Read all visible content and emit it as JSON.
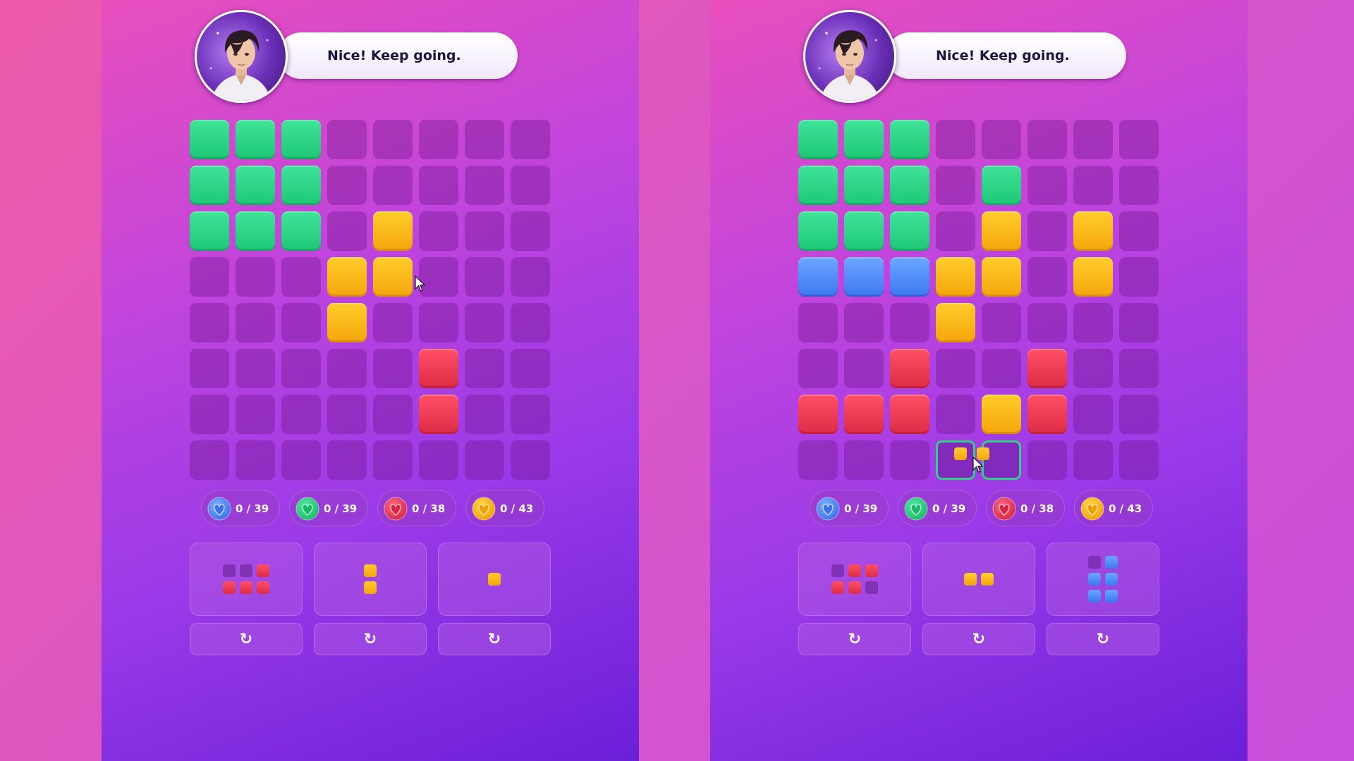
{
  "colors": {
    "green": "#22cc7a",
    "yellow": "#f7b315",
    "red": "#e8364f",
    "blue": "#4a86f5",
    "empty": "#8a2bb0",
    "highlight": "#2fd182"
  },
  "panels": [
    {
      "id": "left",
      "speech": "Nice! Keep going.",
      "grid": [
        [
          "G",
          "G",
          "G",
          ".",
          ".",
          ".",
          ".",
          "."
        ],
        [
          "G",
          "G",
          "G",
          ".",
          ".",
          ".",
          ".",
          "."
        ],
        [
          "G",
          "G",
          "G",
          ".",
          "Y",
          ".",
          ".",
          "."
        ],
        [
          ".",
          ".",
          ".",
          "Y",
          "Y",
          ".",
          ".",
          "."
        ],
        [
          ".",
          ".",
          ".",
          "Y",
          ".",
          ".",
          ".",
          "."
        ],
        [
          ".",
          ".",
          ".",
          ".",
          ".",
          "R",
          ".",
          "."
        ],
        [
          ".",
          ".",
          ".",
          ".",
          ".",
          "R",
          ".",
          "."
        ],
        [
          ".",
          ".",
          ".",
          ".",
          ".",
          ".",
          ".",
          "."
        ]
      ],
      "highlight": [],
      "counters": [
        {
          "color": "blue",
          "text": "0 / 39",
          "icon": "blue-heart-gem-icon"
        },
        {
          "color": "green",
          "text": "0 / 39",
          "icon": "green-heart-gem-icon"
        },
        {
          "color": "red",
          "text": "0 / 38",
          "icon": "red-heart-gem-icon"
        },
        {
          "color": "yellow",
          "text": "0 / 43",
          "icon": "yellow-heart-gem-icon"
        }
      ],
      "pieces": [
        {
          "cells": [
            [
              "dim",
              "dim",
              "red"
            ],
            [
              "red",
              "red",
              "red"
            ]
          ]
        },
        {
          "cells": [
            [
              "yellow"
            ],
            [
              "yellow"
            ]
          ]
        },
        {
          "cells": [
            [
              "yellow"
            ]
          ]
        }
      ],
      "rotate_label": "↻"
    },
    {
      "id": "right",
      "speech": "Nice! Keep going.",
      "grid": [
        [
          "G",
          "G",
          "G",
          ".",
          ".",
          ".",
          ".",
          "."
        ],
        [
          "G",
          "G",
          "G",
          ".",
          "G",
          ".",
          ".",
          "."
        ],
        [
          "G",
          "G",
          "G",
          ".",
          "Y",
          ".",
          "Y",
          "."
        ],
        [
          "B",
          "B",
          "B",
          "Y",
          "Y",
          ".",
          "Y",
          "."
        ],
        [
          ".",
          ".",
          ".",
          "Y",
          ".",
          ".",
          ".",
          "."
        ],
        [
          ".",
          ".",
          "R",
          ".",
          ".",
          "R",
          ".",
          "."
        ],
        [
          "R",
          "R",
          "R",
          ".",
          "Y",
          "R",
          ".",
          "."
        ],
        [
          ".",
          ".",
          ".",
          ".",
          ".",
          ".",
          ".",
          "."
        ]
      ],
      "highlight": [
        [
          7,
          3
        ],
        [
          7,
          4
        ]
      ],
      "counters": [
        {
          "color": "blue",
          "text": "0 / 39",
          "icon": "blue-heart-gem-icon"
        },
        {
          "color": "green",
          "text": "0 / 39",
          "icon": "green-heart-gem-icon"
        },
        {
          "color": "red",
          "text": "0 / 38",
          "icon": "red-heart-gem-icon"
        },
        {
          "color": "yellow",
          "text": "0 / 43",
          "icon": "yellow-heart-gem-icon"
        }
      ],
      "pieces": [
        {
          "cells": [
            [
              "dim",
              "red",
              "red"
            ],
            [
              "red",
              "red",
              "dim"
            ]
          ]
        },
        {
          "cells": [
            [
              "yellow",
              "yellow"
            ]
          ]
        },
        {
          "cells": [
            [
              "dim",
              "blue"
            ],
            [
              "blue",
              "blue"
            ],
            [
              "blue",
              "blue"
            ]
          ]
        }
      ],
      "rotate_label": "↻"
    }
  ]
}
